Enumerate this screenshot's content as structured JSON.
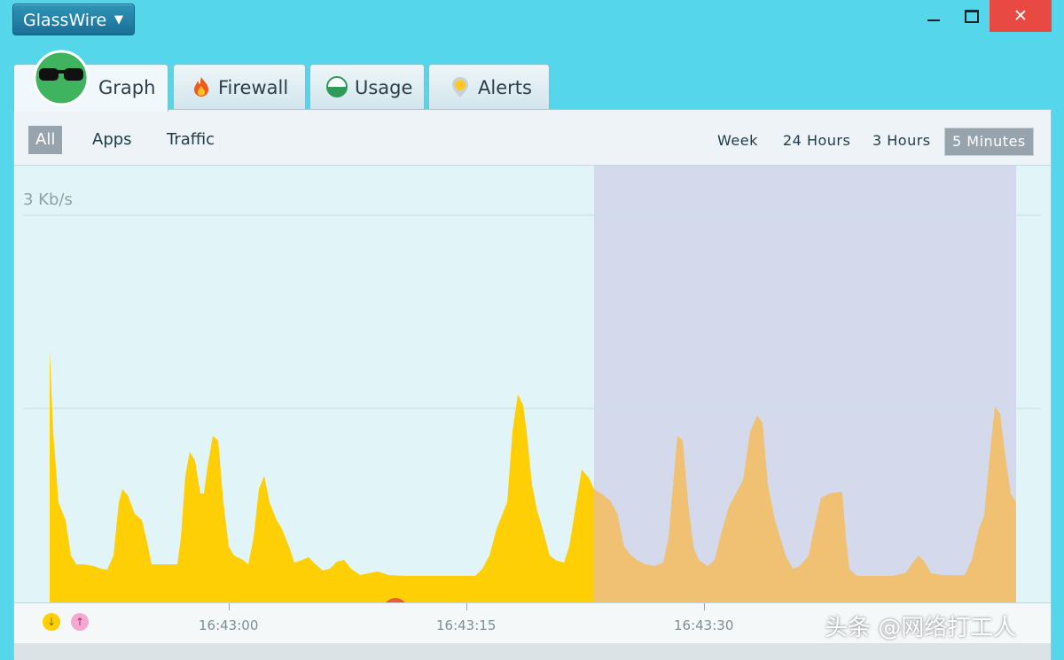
{
  "app_menu": {
    "label": "GlassWire"
  },
  "window_controls": {
    "close_symbol": "✕"
  },
  "tabs": [
    {
      "label": "Graph",
      "icon": "glasswire-logo-icon",
      "active": true
    },
    {
      "label": "Firewall",
      "icon": "flame-icon"
    },
    {
      "label": "Usage",
      "icon": "usage-dial-icon"
    },
    {
      "label": "Alerts",
      "icon": "alert-pin-icon"
    }
  ],
  "filters": [
    {
      "label": "All",
      "selected": true
    },
    {
      "label": "Apps"
    },
    {
      "label": "Traffic"
    }
  ],
  "time_ranges": [
    {
      "label": "Week"
    },
    {
      "label": "24 Hours"
    },
    {
      "label": "3 Hours"
    },
    {
      "label": "5 Minutes",
      "selected": true
    }
  ],
  "graph": {
    "y_label": "3 Kb/s",
    "colors": {
      "incoming": "#ffcf05",
      "incoming_dimmed": "#f0c172",
      "highlight_region": "#d4d9ec",
      "background": "#e1f4f8"
    },
    "time_labels": [
      "16:43:00",
      "16:43:15",
      "16:43:30"
    ],
    "legend": {
      "incoming_symbol": "↓",
      "outgoing_symbol": "↑"
    }
  },
  "chart_data": {
    "type": "area",
    "ylabel": "3 Kb/s",
    "series": [
      {
        "values": [
          1.5,
          0.1,
          0.1,
          0.6,
          0.1,
          0.9,
          0.9,
          0.7,
          0.2,
          0.1,
          0.1,
          0.05,
          0.05,
          0.05,
          0.05,
          0.05,
          0.05,
          0.05,
          0.2,
          1.05,
          0.3,
          0.4,
          0.5,
          0.2,
          0.1,
          0.9,
          0.1,
          0.2,
          0.6,
          0.9,
          0.3,
          0.25,
          0.15,
          0.45,
          0.2,
          0.1,
          0.05,
          0.05,
          0.05,
          0.2,
          1.15
        ]
      }
    ],
    "x_ticks": [
      "16:43:00",
      "16:43:15",
      "16:43:30"
    ]
  },
  "watermark": {
    "text": "头条 @网络打工人"
  }
}
